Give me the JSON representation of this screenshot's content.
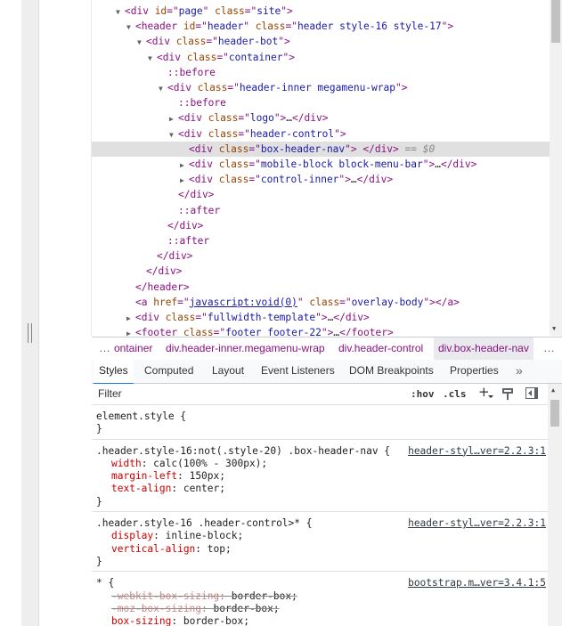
{
  "tree": {
    "lines": [
      {
        "indent": 30,
        "tri": "▼",
        "parts": [
          [
            "tag",
            "<div "
          ],
          [
            "attr",
            "id"
          ],
          [
            "tag",
            "=\""
          ],
          [
            "val",
            "page"
          ],
          [
            "tag",
            "\" "
          ],
          [
            "attr",
            "class"
          ],
          [
            "tag",
            "=\""
          ],
          [
            "val",
            "site"
          ],
          [
            "tag",
            "\">"
          ]
        ]
      },
      {
        "indent": 42,
        "tri": "▼",
        "parts": [
          [
            "tag",
            "<header "
          ],
          [
            "attr",
            "id"
          ],
          [
            "tag",
            "=\""
          ],
          [
            "val",
            "header"
          ],
          [
            "tag",
            "\" "
          ],
          [
            "attr",
            "class"
          ],
          [
            "tag",
            "=\""
          ],
          [
            "val",
            "header style-16 style-17"
          ],
          [
            "tag",
            "\">"
          ]
        ]
      },
      {
        "indent": 54,
        "tri": "▼",
        "parts": [
          [
            "tag",
            "<div "
          ],
          [
            "attr",
            "class"
          ],
          [
            "tag",
            "=\""
          ],
          [
            "val",
            "header-bot"
          ],
          [
            "tag",
            "\">"
          ]
        ]
      },
      {
        "indent": 66,
        "tri": "▼",
        "parts": [
          [
            "tag",
            "<div "
          ],
          [
            "attr",
            "class"
          ],
          [
            "tag",
            "=\""
          ],
          [
            "val",
            "container"
          ],
          [
            "tag",
            "\">"
          ]
        ]
      },
      {
        "indent": 78,
        "tri": "",
        "parts": [
          [
            "pseudo",
            "::before"
          ]
        ]
      },
      {
        "indent": 78,
        "tri": "▼",
        "parts": [
          [
            "tag",
            "<div "
          ],
          [
            "attr",
            "class"
          ],
          [
            "tag",
            "=\""
          ],
          [
            "val",
            "header-inner megamenu-wrap"
          ],
          [
            "tag",
            "\">"
          ]
        ]
      },
      {
        "indent": 90,
        "tri": "",
        "parts": [
          [
            "pseudo",
            "::before"
          ]
        ]
      },
      {
        "indent": 90,
        "tri": "▶",
        "parts": [
          [
            "tag",
            "<div "
          ],
          [
            "attr",
            "class"
          ],
          [
            "tag",
            "=\""
          ],
          [
            "val",
            "logo"
          ],
          [
            "tag",
            "\">"
          ],
          [
            "txt",
            "…"
          ],
          [
            "tag",
            "</div>"
          ]
        ]
      },
      {
        "indent": 90,
        "tri": "▼",
        "parts": [
          [
            "tag",
            "<div "
          ],
          [
            "attr",
            "class"
          ],
          [
            "tag",
            "=\""
          ],
          [
            "val",
            "header-control"
          ],
          [
            "tag",
            "\">"
          ]
        ]
      },
      {
        "indent": 102,
        "tri": "",
        "selected": true,
        "parts": [
          [
            "tag",
            "<div "
          ],
          [
            "attr",
            "class"
          ],
          [
            "tag",
            "=\""
          ],
          [
            "val",
            "box-header-nav"
          ],
          [
            "tag",
            "\"> </div>"
          ],
          [
            "dollar",
            " == $0"
          ]
        ]
      },
      {
        "indent": 102,
        "tri": "▶",
        "parts": [
          [
            "tag",
            "<div "
          ],
          [
            "attr",
            "class"
          ],
          [
            "tag",
            "=\""
          ],
          [
            "val",
            "mobile-block block-menu-bar"
          ],
          [
            "tag",
            "\">"
          ],
          [
            "txt",
            "…"
          ],
          [
            "tag",
            "</div>"
          ]
        ]
      },
      {
        "indent": 102,
        "tri": "▶",
        "parts": [
          [
            "tag",
            "<div "
          ],
          [
            "attr",
            "class"
          ],
          [
            "tag",
            "=\""
          ],
          [
            "val",
            "control-inner"
          ],
          [
            "tag",
            "\">"
          ],
          [
            "txt",
            "…"
          ],
          [
            "tag",
            "</div>"
          ]
        ]
      },
      {
        "indent": 90,
        "tri": "",
        "parts": [
          [
            "tag",
            "</div>"
          ]
        ]
      },
      {
        "indent": 90,
        "tri": "",
        "parts": [
          [
            "pseudo",
            "::after"
          ]
        ]
      },
      {
        "indent": 78,
        "tri": "",
        "parts": [
          [
            "tag",
            "</div>"
          ]
        ]
      },
      {
        "indent": 78,
        "tri": "",
        "parts": [
          [
            "pseudo",
            "::after"
          ]
        ]
      },
      {
        "indent": 66,
        "tri": "",
        "parts": [
          [
            "tag",
            "</div>"
          ]
        ]
      },
      {
        "indent": 54,
        "tri": "",
        "parts": [
          [
            "tag",
            "</div>"
          ]
        ]
      },
      {
        "indent": 42,
        "tri": "",
        "parts": [
          [
            "tag",
            "</header>"
          ]
        ]
      },
      {
        "indent": 42,
        "tri": "",
        "parts": [
          [
            "tag",
            "<a "
          ],
          [
            "attr",
            "href"
          ],
          [
            "tag",
            "=\""
          ],
          [
            "link",
            "javascript:void(0)"
          ],
          [
            "tag",
            "\" "
          ],
          [
            "attr",
            "class"
          ],
          [
            "tag",
            "=\""
          ],
          [
            "val",
            "overlay-body"
          ],
          [
            "tag",
            "\"></a>"
          ]
        ]
      },
      {
        "indent": 42,
        "tri": "▶",
        "parts": [
          [
            "tag",
            "<div "
          ],
          [
            "attr",
            "class"
          ],
          [
            "tag",
            "=\""
          ],
          [
            "val",
            "fullwidth-template"
          ],
          [
            "tag",
            "\">"
          ],
          [
            "txt",
            "…"
          ],
          [
            "tag",
            "</div>"
          ]
        ]
      },
      {
        "indent": 42,
        "tri": "▶",
        "parts": [
          [
            "tag",
            "<footer "
          ],
          [
            "attr",
            "class"
          ],
          [
            "tag",
            "=\""
          ],
          [
            "val",
            "footer footer-22"
          ],
          [
            "tag",
            "\">"
          ],
          [
            "txt",
            "…"
          ],
          [
            "tag",
            "</footer>"
          ]
        ]
      }
    ],
    "gutter_dots": "…"
  },
  "breadcrumbs": {
    "left_ellipsis": "…",
    "items": [
      {
        "label": "ontainer",
        "active": false
      },
      {
        "label": "div.header-inner.megamenu-wrap",
        "active": false
      },
      {
        "label": "div.header-control",
        "active": false
      },
      {
        "label": "div.box-header-nav",
        "active": true
      }
    ],
    "right_ellipsis": "…"
  },
  "tabs": {
    "items": [
      "Styles",
      "Computed",
      "Layout",
      "Event Listeners",
      "DOM Breakpoints",
      "Properties"
    ],
    "active": "Styles",
    "overflow": "»"
  },
  "filter": {
    "placeholder": "Filter",
    "hov": ":hov",
    "cls": ".cls",
    "plus": "+"
  },
  "styles": {
    "rules": [
      {
        "selector": "element.style {",
        "source": "",
        "decls": [],
        "close": "}"
      },
      {
        "selector": ".header.style-16:not(.style-20) .box-header-nav {",
        "source": "header-styl…ver=2.2.3:1",
        "decls": [
          [
            "width",
            "calc(100% - 300px);",
            false
          ],
          [
            "margin-left",
            "150px;",
            false
          ],
          [
            "text-align",
            "center;",
            false
          ]
        ],
        "close": "}"
      },
      {
        "selector": ".header.style-16 .header-control>* {",
        "source": "header-styl…ver=2.2.3:1",
        "decls": [
          [
            "display",
            "inline-block;",
            false
          ],
          [
            "vertical-align",
            "top;",
            false
          ]
        ],
        "close": "}"
      },
      {
        "selector": "* {",
        "source": "bootstrap.m…ver=3.4.1:5",
        "decls": [
          [
            "-webkit-box-sizing",
            "border-box;",
            true
          ],
          [
            "-moz-box-sizing",
            "border-box;",
            true
          ],
          [
            "box-sizing",
            "border-box;",
            false
          ]
        ],
        "close": "}"
      }
    ]
  }
}
